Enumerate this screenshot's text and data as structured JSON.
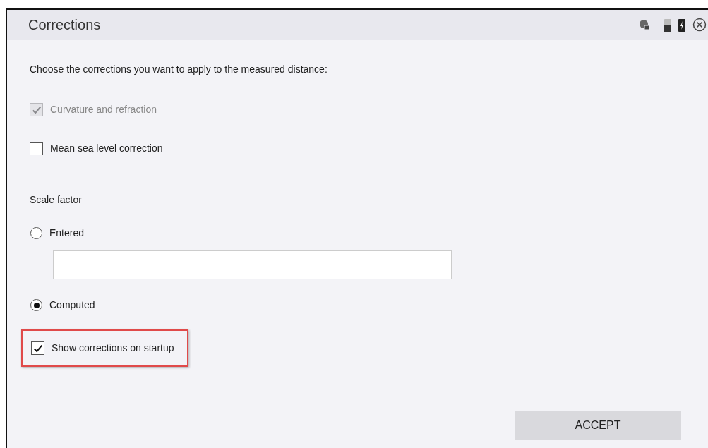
{
  "window": {
    "title": "Corrections"
  },
  "intro": "Choose the corrections you want to apply to the measured distance:",
  "corrections": [
    {
      "label": "Curvature and refraction",
      "checked": true,
      "disabled": true
    },
    {
      "label": "Mean sea level correction",
      "checked": false,
      "disabled": false
    }
  ],
  "scale_factor": {
    "heading": "Scale factor",
    "options": [
      {
        "label": "Entered",
        "selected": false,
        "kind": "field"
      },
      {
        "label": "Computed",
        "selected": true,
        "kind": "plain"
      }
    ]
  },
  "startup": {
    "label": "Show corrections on startup",
    "checked": true,
    "highlighted": true
  },
  "buttons": [
    "ACCEPT"
  ]
}
